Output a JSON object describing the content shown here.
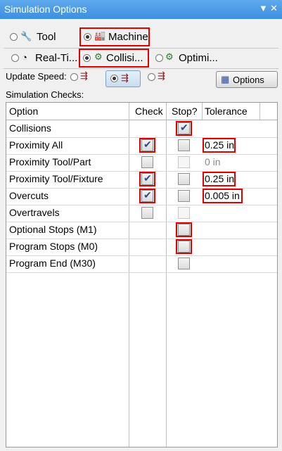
{
  "window": {
    "title": "Simulation Options"
  },
  "mode_row1": [
    {
      "label": "Tool",
      "selected": false,
      "icon": "tool-icon"
    },
    {
      "label": "Machine",
      "selected": true,
      "icon": "machine-icon"
    }
  ],
  "mode_row2": [
    {
      "label": "Real-Ti...",
      "selected": false,
      "icon": "clock-icon"
    },
    {
      "label": "Collisi...",
      "selected": true,
      "icon": "collision-icon"
    },
    {
      "label": "Optimi...",
      "selected": false,
      "icon": "optimize-icon"
    }
  ],
  "update_speed": {
    "label": "Update Speed:",
    "options_button": "Options"
  },
  "checks": {
    "label": "Simulation Checks:",
    "columns": [
      "Option",
      "Check",
      "Stop?",
      "Tolerance"
    ],
    "rows": [
      {
        "name": "Collisions",
        "check": null,
        "stop": true,
        "stop_enabled": true,
        "tolerance": ""
      },
      {
        "name": "Proximity All",
        "check": true,
        "stop": false,
        "stop_enabled": true,
        "tolerance": "0.25 in"
      },
      {
        "name": "Proximity Tool/Part",
        "check": false,
        "stop": false,
        "stop_enabled": false,
        "tolerance": "0 in"
      },
      {
        "name": "Proximity Tool/Fixture",
        "check": true,
        "stop": false,
        "stop_enabled": true,
        "tolerance": "0.25 in"
      },
      {
        "name": "Overcuts",
        "check": true,
        "stop": false,
        "stop_enabled": true,
        "tolerance": "0.005 in"
      },
      {
        "name": "Overtravels",
        "check": false,
        "stop": false,
        "stop_enabled": false,
        "tolerance": ""
      },
      {
        "name": "Optional Stops (M1)",
        "check": null,
        "stop": false,
        "stop_enabled": true,
        "tolerance": ""
      },
      {
        "name": "Program Stops (M0)",
        "check": null,
        "stop": false,
        "stop_enabled": true,
        "tolerance": ""
      },
      {
        "name": "Program End (M30)",
        "check": null,
        "stop": false,
        "stop_enabled": true,
        "tolerance": ""
      }
    ]
  },
  "colors": {
    "highlight": "#e00000",
    "titlebar": "#4a9be6"
  }
}
